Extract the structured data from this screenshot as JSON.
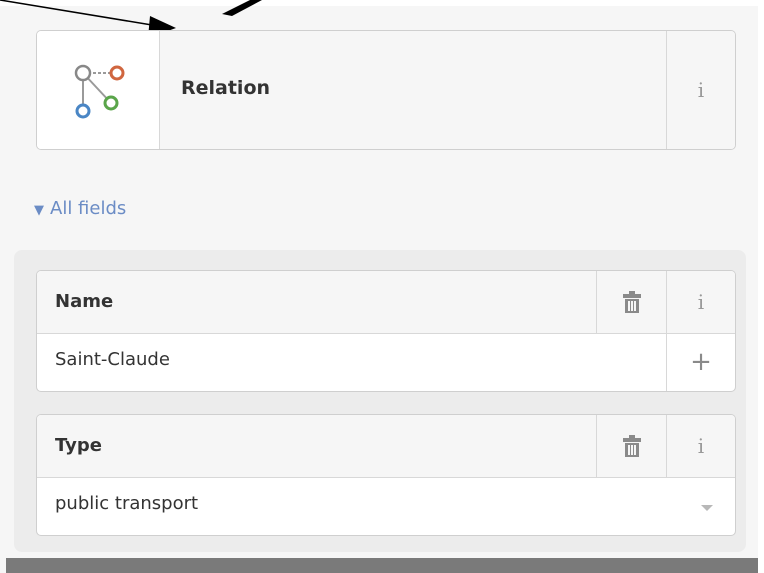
{
  "preset": {
    "name": "Relation",
    "info_label": "i",
    "icon": "relation-icon"
  },
  "all_fields": {
    "label": "All fields",
    "expanded": true
  },
  "fields": [
    {
      "label": "Name",
      "value": "Saint-Claude",
      "info_label": "i",
      "action": "+",
      "action_icon": "plus-icon",
      "delete_icon": "trash-icon"
    },
    {
      "label": "Type",
      "value": "public transport",
      "info_label": "i",
      "action_icon": "dropdown-caret-icon",
      "delete_icon": "trash-icon"
    }
  ],
  "colors": {
    "link": "#6b8cc5",
    "relation_orange": "#d0663f",
    "relation_green": "#5aa54a",
    "relation_blue": "#4a86c5"
  }
}
